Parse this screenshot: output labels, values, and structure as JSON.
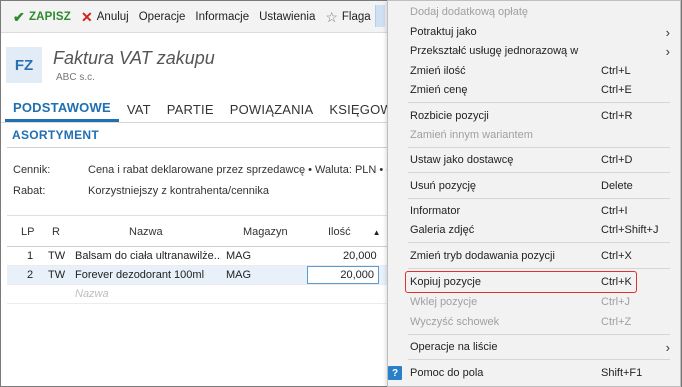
{
  "toolbar": {
    "save_label": "ZAPISZ",
    "cancel_label": "Anuluj",
    "operations_label": "Operacje",
    "info_label": "Informacje",
    "settings_label": "Ustawienia",
    "flag_label": "Flaga"
  },
  "header": {
    "badge": "FZ",
    "title": "Faktura VAT zakupu",
    "subtitle": "ABC s.c."
  },
  "tabs": [
    "PODSTAWOWE",
    "VAT",
    "PARTIE",
    "POWIĄZANIA",
    "KSIĘGOWO"
  ],
  "section": {
    "title": "ASORTYMENT",
    "fields": [
      {
        "label": "Cennik:",
        "value": "Cena i rabat deklarowane przez sprzedawcę • Waluta: PLN • od"
      },
      {
        "label": "Rabat:",
        "value": "Korzystniejszy z kontrahenta/cennika"
      }
    ]
  },
  "grid": {
    "columns": [
      "LP",
      "R",
      "Nazwa",
      "Magazyn",
      "Ilość"
    ],
    "rows": [
      {
        "lp": "1",
        "r": "TW",
        "nazwa": "Balsam do ciała ultranawilże...",
        "magazyn": "MAG",
        "ilosc": "20,000"
      },
      {
        "lp": "2",
        "r": "TW",
        "nazwa": "Forever dezodorant 100ml",
        "magazyn": "MAG",
        "ilosc": "20,000"
      }
    ],
    "new_row_placeholder": "Nazwa"
  },
  "context_menu": {
    "items": [
      {
        "label": "Dodaj dodatkową opłatę",
        "shortcut": "",
        "disabled": true
      },
      {
        "label": "Potraktuj jako",
        "shortcut": "",
        "submenu": true
      },
      {
        "label": "Przekształć usługę jednorazową w",
        "shortcut": "",
        "submenu": true
      },
      {
        "label": "Zmień ilość",
        "shortcut": "Ctrl+L"
      },
      {
        "label": "Zmień cenę",
        "shortcut": "Ctrl+E"
      },
      {
        "label": "Rozbicie pozycji",
        "shortcut": "Ctrl+R"
      },
      {
        "label": "Zamień innym wariantem",
        "shortcut": "",
        "disabled": true
      },
      {
        "label": "Ustaw jako dostawcę",
        "shortcut": "Ctrl+D"
      },
      {
        "label": "Usuń pozycję",
        "shortcut": "Delete"
      },
      {
        "label": "Informator",
        "shortcut": "Ctrl+I"
      },
      {
        "label": "Galeria zdjęć",
        "shortcut": "Ctrl+Shift+J"
      },
      {
        "label": "Zmień tryb dodawania pozycji",
        "shortcut": "Ctrl+X"
      },
      {
        "label": "Kopiuj pozycje",
        "shortcut": "Ctrl+K"
      },
      {
        "label": "Wklej pozycje",
        "shortcut": "Ctrl+J",
        "disabled": true
      },
      {
        "label": "Wyczyść schowek",
        "shortcut": "Ctrl+Z",
        "disabled": true
      },
      {
        "label": "Operacje na liście",
        "shortcut": "",
        "submenu": true
      },
      {
        "label": "Pomoc do pola",
        "shortcut": "Shift+F1"
      }
    ]
  },
  "colors": {
    "accent": "#1f6fb2",
    "save_green": "#2f8a2f",
    "cancel_red": "#d32020",
    "highlight_border": "#e03030"
  }
}
